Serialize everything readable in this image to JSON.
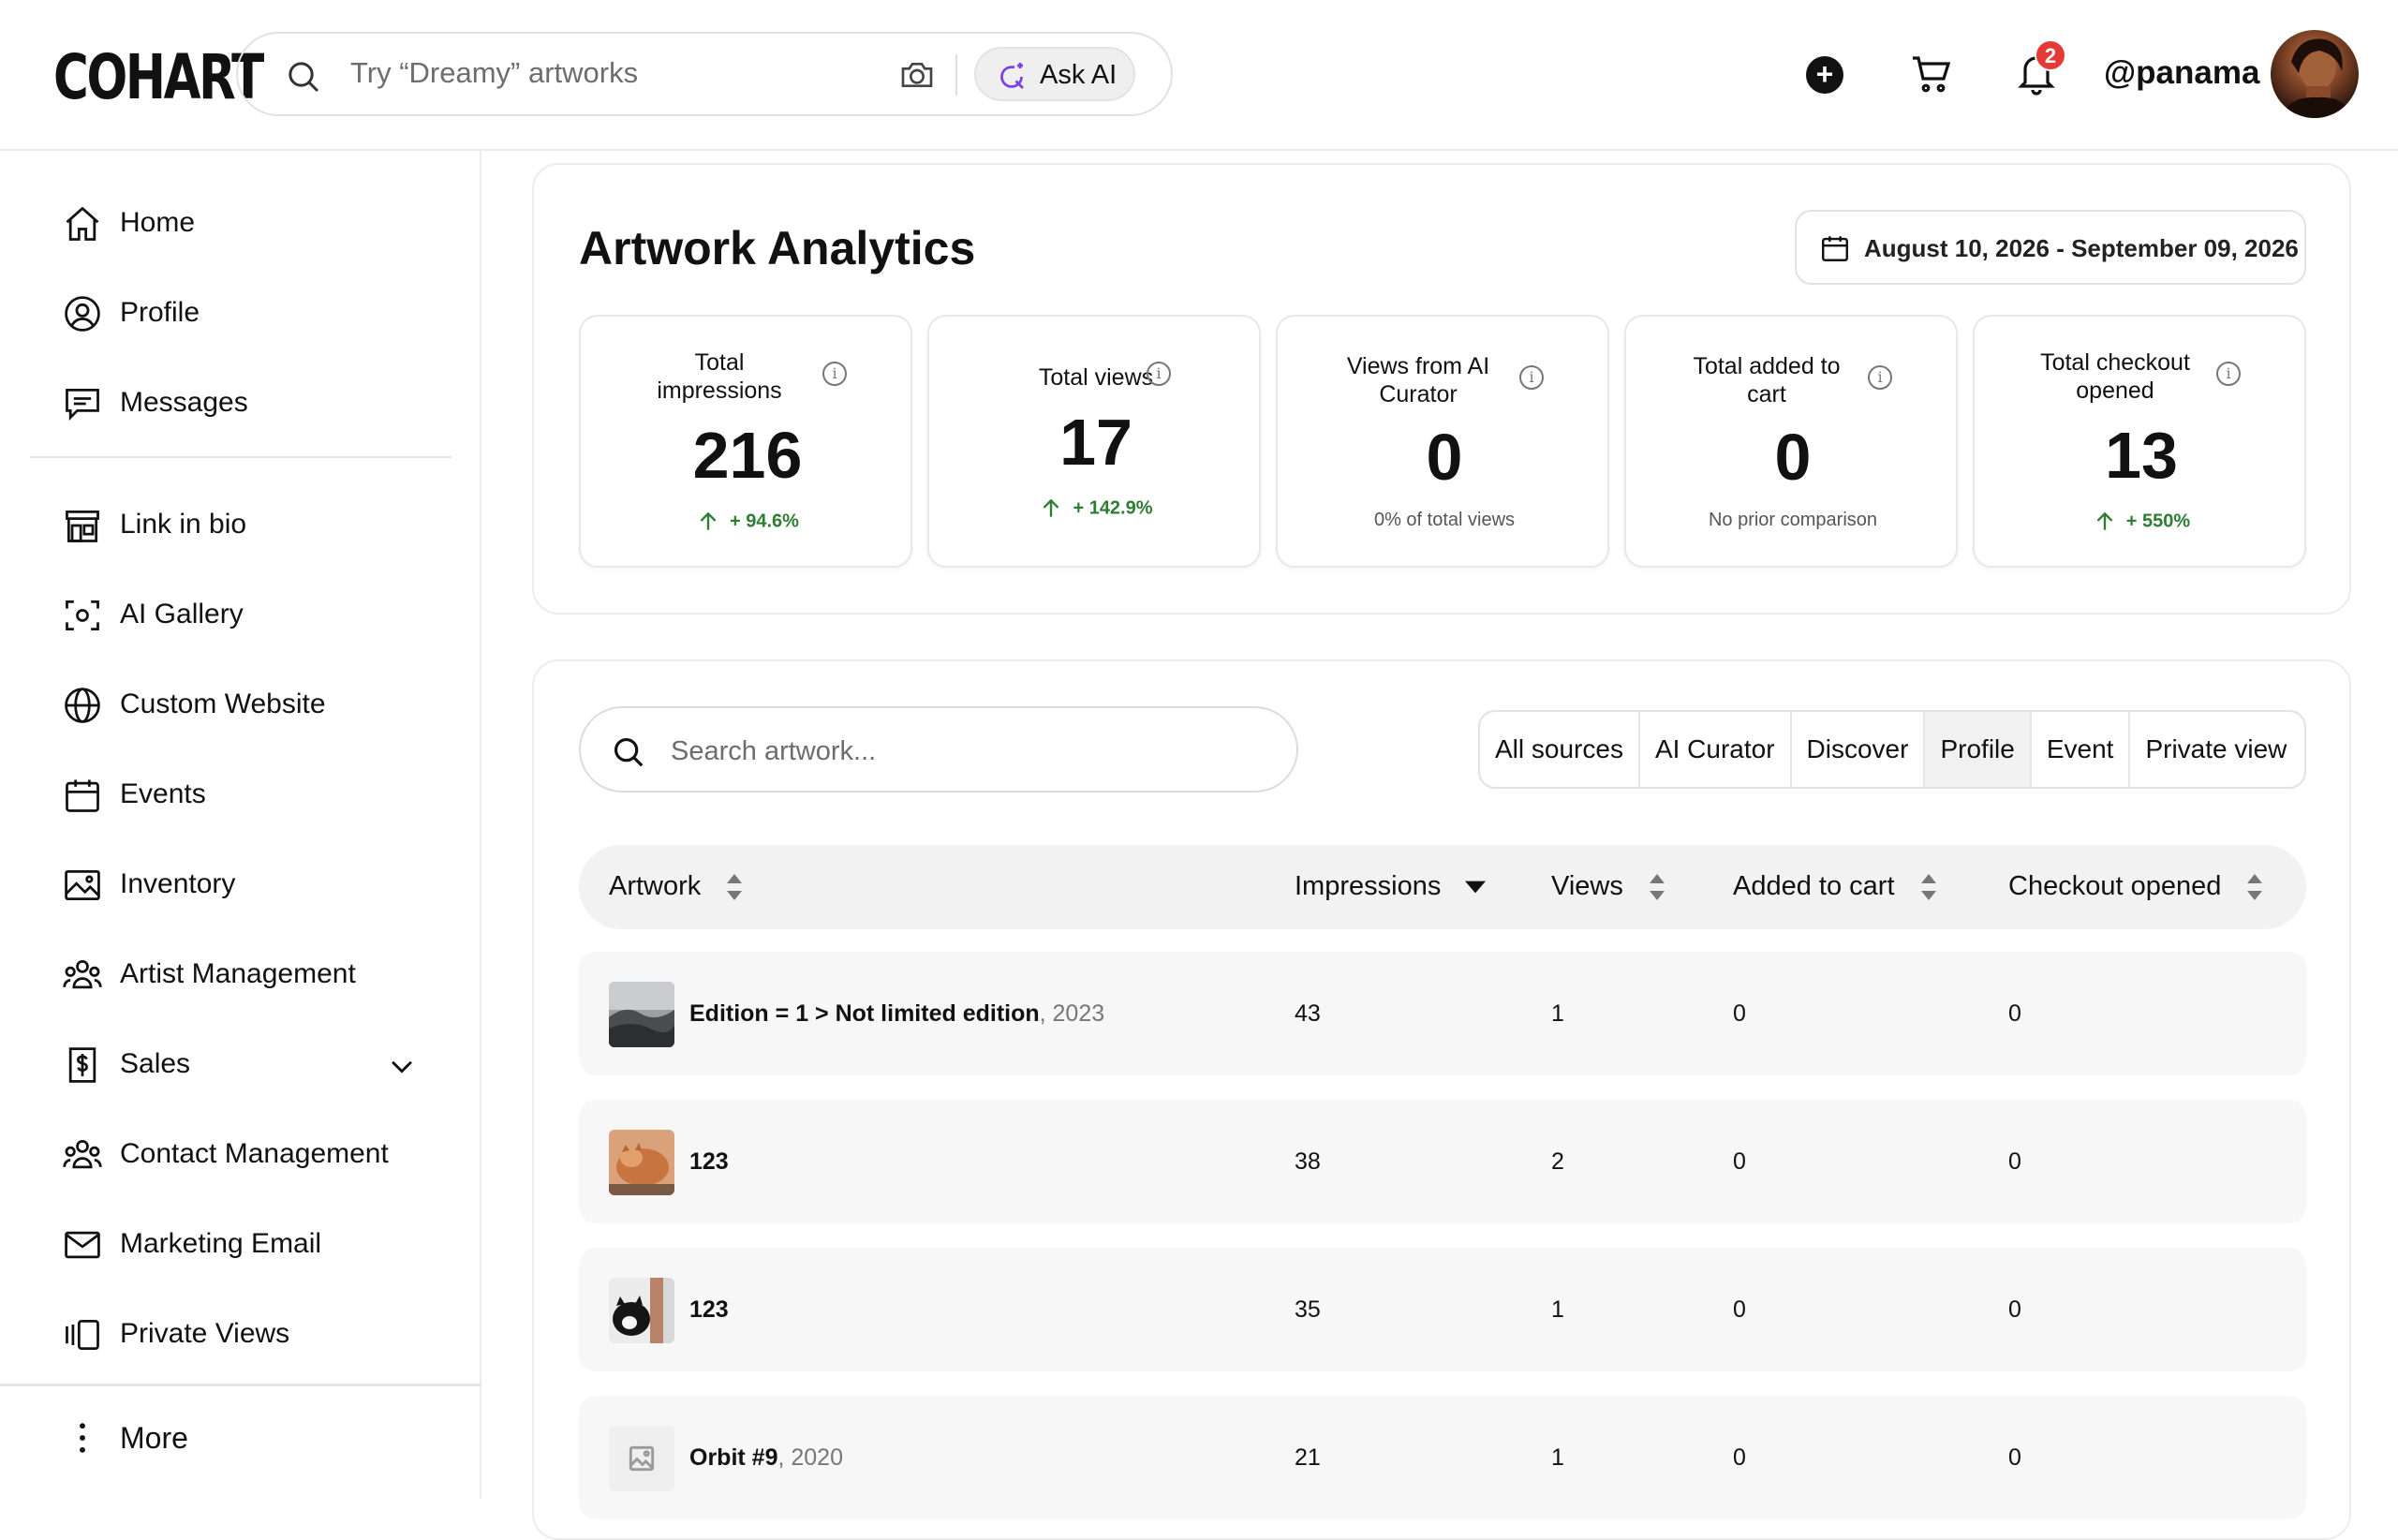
{
  "header": {
    "logo": "COHART",
    "search_placeholder": "Try “Dreamy” artworks",
    "ask_ai": "Ask AI",
    "notification_count": "2",
    "username": "@panama",
    "icons": [
      "search-icon",
      "camera-icon",
      "sparkle-icon",
      "plus-circle-icon",
      "cart-icon",
      "bell-icon"
    ]
  },
  "sidebar": {
    "items": [
      {
        "label": "Home",
        "icon": "home-icon"
      },
      {
        "label": "Profile",
        "icon": "user-circle-icon"
      },
      {
        "label": "Messages",
        "icon": "chat-icon"
      },
      {
        "label": "Link in bio",
        "icon": "storefront-icon"
      },
      {
        "label": "AI Gallery",
        "icon": "scan-icon"
      },
      {
        "label": "Custom Website",
        "icon": "globe-icon"
      },
      {
        "label": "Events",
        "icon": "calendar-icon"
      },
      {
        "label": "Inventory",
        "icon": "image-icon"
      },
      {
        "label": "Artist Management",
        "icon": "users-icon"
      },
      {
        "label": "Sales",
        "icon": "dollar-icon"
      },
      {
        "label": "Contact Management",
        "icon": "users-icon"
      },
      {
        "label": "Marketing Email",
        "icon": "mail-icon"
      },
      {
        "label": "Private Views",
        "icon": "private-views-icon"
      }
    ],
    "more": "More"
  },
  "analytics": {
    "title": "Artwork Analytics",
    "date_range": "August 10, 2026 - September 09, 2026",
    "stats": [
      {
        "title_lines": [
          "Total",
          "impressions"
        ],
        "value": "216",
        "delta": "+ 94.6%",
        "trend": "up"
      },
      {
        "title_lines": [
          "Total views"
        ],
        "value": "17",
        "delta": "+ 142.9%",
        "trend": "up"
      },
      {
        "title_lines": [
          "Views from AI",
          "Curator"
        ],
        "value": "0",
        "note": "0% of total views"
      },
      {
        "title_lines": [
          "Total added to",
          "cart"
        ],
        "value": "0",
        "note": "No prior comparison"
      },
      {
        "title_lines": [
          "Total checkout",
          "opened"
        ],
        "value": "13",
        "delta": "+ 550%",
        "trend": "up"
      }
    ]
  },
  "table": {
    "search_placeholder": "Search artwork...",
    "filters": [
      "All sources",
      "AI Curator",
      "Discover",
      "Profile",
      "Event",
      "Private view"
    ],
    "active_filter": "Profile",
    "columns": [
      "Artwork",
      "Impressions",
      "Views",
      "Added to cart",
      "Checkout opened"
    ],
    "rows": [
      {
        "title": "Edition = 1 > Not limited edition",
        "year": ", 2023",
        "impressions": "43",
        "views": "1",
        "added_to_cart": "0",
        "checkout_opened": "0",
        "thumb": "landscape"
      },
      {
        "title": "123",
        "year": "",
        "impressions": "38",
        "views": "2",
        "added_to_cart": "0",
        "checkout_opened": "0",
        "thumb": "cat-orange"
      },
      {
        "title": "123",
        "year": "",
        "impressions": "35",
        "views": "1",
        "added_to_cart": "0",
        "checkout_opened": "0",
        "thumb": "cat-bw"
      },
      {
        "title": "Orbit #9",
        "year": ", 2020",
        "impressions": "21",
        "views": "1",
        "added_to_cart": "0",
        "checkout_opened": "0",
        "thumb": "placeholder"
      }
    ]
  },
  "colors": {
    "positive": "#2e7d32",
    "badge": "#e53935",
    "text": "#111111"
  }
}
